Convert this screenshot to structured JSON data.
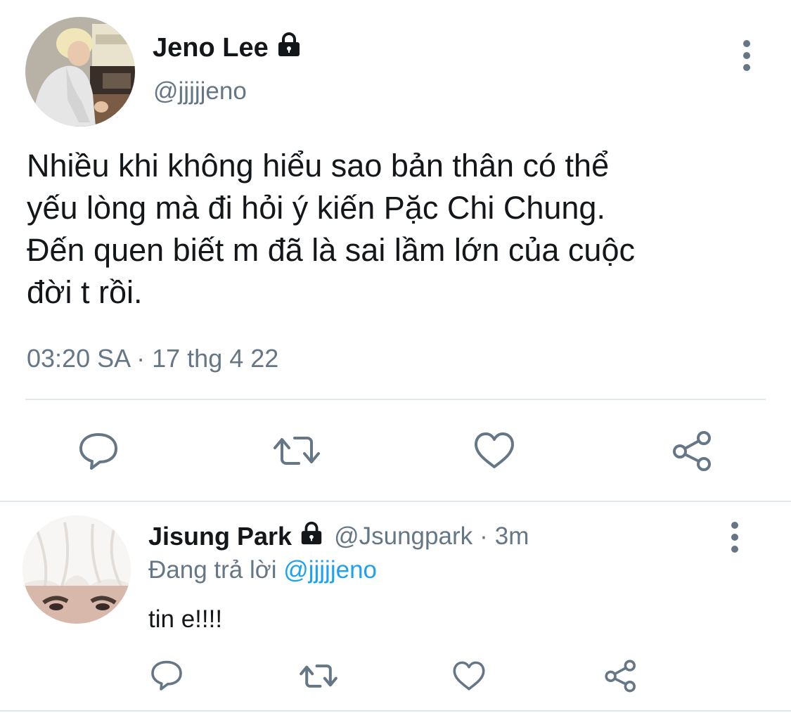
{
  "tweet": {
    "author_name": "Jeno Lee",
    "author_handle": "@jjjjjeno",
    "text_lines": [
      "Nhiều khi không hiểu sao bản thân có thể",
      "yếu lòng mà đi hỏi ý kiến Pặc Chi Chung.",
      "Đến quen biết m đã là sai lầm lớn của cuộc",
      "đời t rồi."
    ],
    "timestamp": "03:20 SA · 17 thg 4 22",
    "protected": true
  },
  "actions": {
    "reply_icon": "reply-icon",
    "retweet_icon": "retweet-icon",
    "like_icon": "heart-icon",
    "share_icon": "share-icon"
  },
  "reply": {
    "author_name": "Jisung Park",
    "author_handle": "@Jsungpark",
    "separator": "·",
    "time": "3m",
    "replying_to_label": "Đang trả lời",
    "replying_to_handle": "@jjjjjeno",
    "text": "tin e!!!!",
    "protected": true
  },
  "colors": {
    "text_primary": "#14171a",
    "text_secondary": "#657786",
    "link": "#1da1f2",
    "divider": "#e1e8ed"
  }
}
